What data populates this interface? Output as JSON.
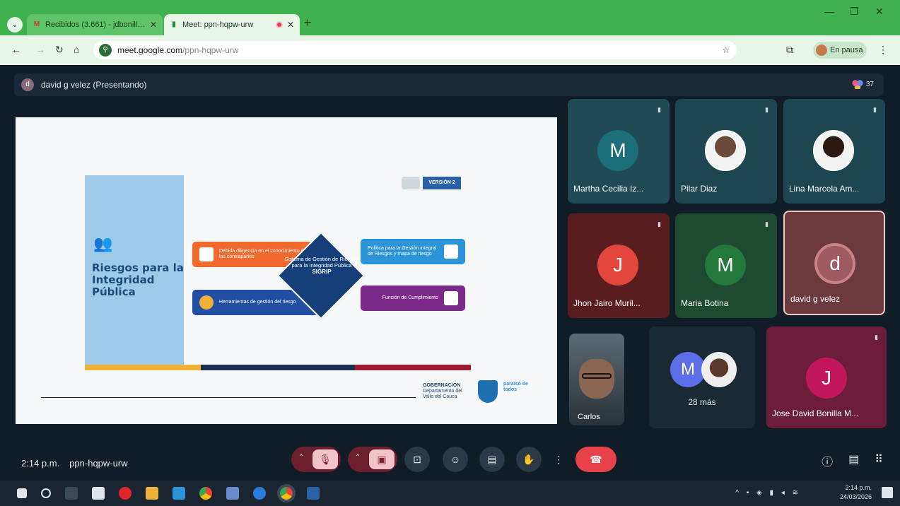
{
  "browser": {
    "tabs": [
      {
        "label": "Recibidos (3.661) - jdbonilla@",
        "icon": "gmail-icon"
      },
      {
        "label": "Meet: ppn-hqpw-urw",
        "icon": "meet-icon"
      }
    ],
    "url_host": "meet.google.com",
    "url_path": "/ppn-hqpw-urw",
    "profile_label": "En pausa"
  },
  "meet": {
    "presenter_label": "david g velez (Presentando)",
    "presenter_initial": "d",
    "participant_count": "37",
    "meeting_time": "2:14 p.m.",
    "meeting_code": "ppn-hqpw-urw",
    "participants": [
      {
        "name": "Martha Cecilia Iz...",
        "initial": "M",
        "tile_color": "#1f4a56",
        "avatar_color": "#1c6e7b"
      },
      {
        "name": "Pilar Diaz",
        "initial": "",
        "tile_color": "#1e4650",
        "avatar_color": ""
      },
      {
        "name": "Lina Marcela Am...",
        "initial": "",
        "tile_color": "#1e4650",
        "avatar_color": ""
      },
      {
        "name": "Jhon Jairo Muril...",
        "initial": "J",
        "tile_color": "#5a1d1f",
        "avatar_color": "#e3473c"
      },
      {
        "name": "Maria Botina",
        "initial": "M",
        "tile_color": "#1d4a30",
        "avatar_color": "#24783c"
      },
      {
        "name": "david g velez",
        "initial": "d",
        "tile_color": "#6b3a3e",
        "avatar_color": "#a05a62"
      },
      {
        "name": "Jose David Bonilla M...",
        "initial": "J",
        "tile_color": "#6b1d3a",
        "avatar_color": "#c2185b"
      }
    ],
    "self_name": "Carlos",
    "more_initial": "M",
    "more_label": "28 más"
  },
  "slide": {
    "title": "Riesgos para la Integridad Pública",
    "badge": "VERSIÓN 2",
    "items": [
      "Debida diligencia en el conocimiento de las contrapartes",
      "Política para la Gestión integral de Riesgos y mapa de riesgo",
      "Herramientas de gestión del riesgo",
      "Función de Cumplimiento"
    ],
    "center_text": "Sistema de Gestión de Riesgos para la Integridad Pública",
    "center_acronym": "SIGRIP",
    "gov_label": "GOBERNACIÓN",
    "gov_sub": "Departamento del Valle del Cauca",
    "paraiso_label": "paraíso de todos"
  },
  "taskbar": {
    "time": "2:14 p.m.",
    "date": "24/03/2026"
  },
  "colors": {
    "tab_bar": "#3fb24f",
    "hangup": "#e7414a",
    "meet_bg": "#101c26"
  }
}
